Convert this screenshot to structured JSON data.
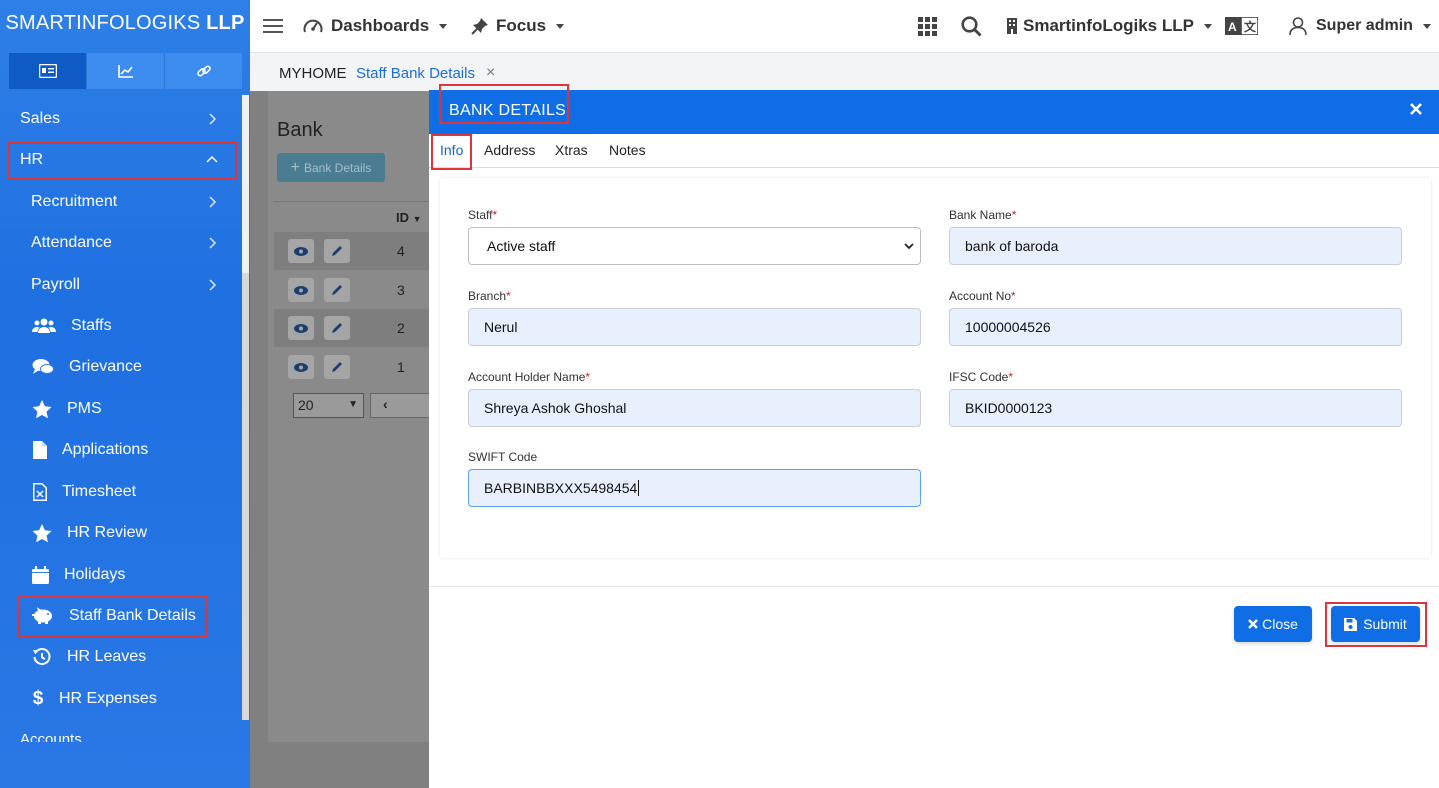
{
  "brand": {
    "name": "SMARTINFOLOGIKS",
    "suffix": "LLP"
  },
  "sidebar": {
    "tabs": [
      {
        "icon": "id-card-icon"
      },
      {
        "icon": "chart-icon"
      },
      {
        "icon": "link-icon"
      }
    ],
    "items": [
      {
        "label": "Sales"
      },
      {
        "label": "HR"
      },
      {
        "label": "Recruitment"
      },
      {
        "label": "Attendance"
      },
      {
        "label": "Payroll"
      },
      {
        "label": "Staffs"
      },
      {
        "label": "Grievance"
      },
      {
        "label": "PMS"
      },
      {
        "label": "Applications"
      },
      {
        "label": "Timesheet"
      },
      {
        "label": "HR Review"
      },
      {
        "label": "Holidays"
      },
      {
        "label": "Staff Bank Details"
      },
      {
        "label": "HR Leaves"
      },
      {
        "label": "HR Expenses"
      },
      {
        "label": "Accounts"
      }
    ]
  },
  "topbar": {
    "dashboards": "Dashboards",
    "focus": "Focus",
    "company": "SmartinfoLogiks LLP",
    "user": "Super admin"
  },
  "breadcrumb": {
    "home": "MYHOME",
    "current": "Staff Bank Details",
    "close": "×"
  },
  "background_page": {
    "title": "Bank",
    "add_button": "Bank Details",
    "id_header": "ID",
    "rows": [
      "4",
      "3",
      "2",
      "1"
    ],
    "page_size": "20"
  },
  "modal": {
    "title": "BANK DETAILS",
    "tabs": [
      "Info",
      "Address",
      "Xtras",
      "Notes"
    ],
    "fields": {
      "staff": {
        "label": "Staff",
        "value": "Active staff"
      },
      "bank_name": {
        "label": "Bank Name",
        "value": "bank of baroda"
      },
      "branch": {
        "label": "Branch",
        "value": "Nerul"
      },
      "account_no": {
        "label": "Account No",
        "value": "10000004526"
      },
      "holder": {
        "label": "Account Holder Name",
        "value": "Shreya Ashok Ghoshal"
      },
      "ifsc": {
        "label": "IFSC Code",
        "value": "BKID0000123"
      },
      "swift": {
        "label": "SWIFT Code",
        "value": "BARBINBBXXX5498454"
      }
    },
    "required_mark": "*",
    "close_button": "Close",
    "submit_button": "Submit"
  },
  "colors": {
    "primary": "#0f6ee5",
    "highlight": "#d9373b",
    "sidebar": "#1e6fe0"
  }
}
